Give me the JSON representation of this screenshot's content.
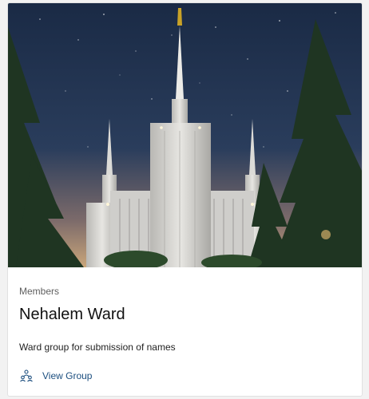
{
  "card": {
    "category_label": "Members",
    "title": "Nehalem Ward",
    "description": "Ward group for submission of names",
    "action": {
      "label": "View Group",
      "icon": "group-people-icon"
    }
  },
  "colors": {
    "link": "#1b4e7f",
    "night_sky": "#15203a",
    "tree": "#1e3320"
  }
}
